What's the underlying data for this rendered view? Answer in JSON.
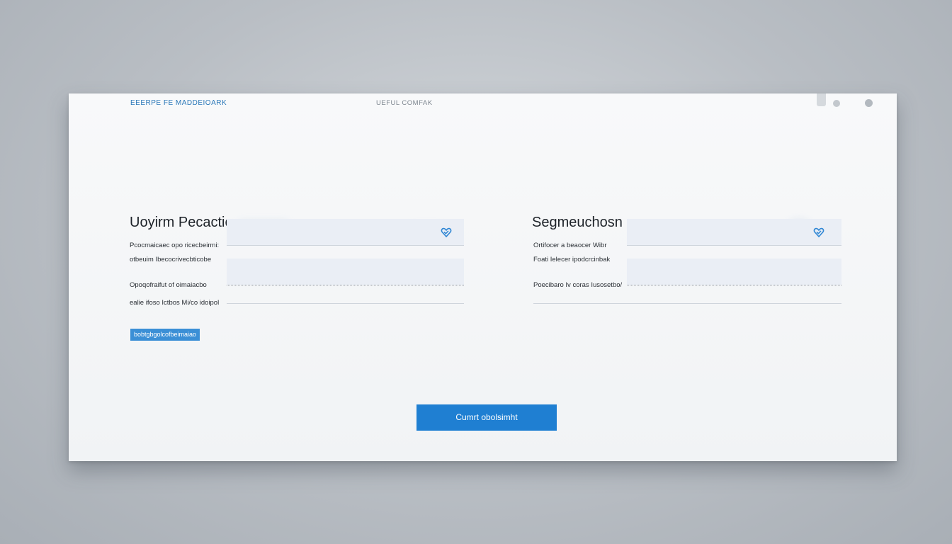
{
  "header": {
    "brand": "EEERPE FE ΜΑDDEIOARK",
    "nav_label": "UEFUL   COMFAK"
  },
  "left_panel": {
    "title": "Uoyirm Pecactio",
    "labels": [
      "Pcocmaicaec opo ricecbeirmi:",
      "otbeuim Ibecocrivecbticobe",
      "Opoqofraifut of oimaiacbo",
      "ealie ifoso Ictbos Mi/co idoipol"
    ],
    "small_button": "bobtgbgolcofbeimaiao"
  },
  "right_panel": {
    "title": "Segmeuchosn",
    "labels": [
      "Ortifocer a beaocer Wibr",
      "Foati  Ielecer ipodcrcinbak",
      "Poecibaro Iv coras Iusosetbo/"
    ]
  },
  "footer": {
    "submit_label": "Cumrt obolsimht"
  },
  "colors": {
    "accent": "#1f7fd2",
    "small_button": "#3b8fd6",
    "brand_text": "#2a78b8",
    "check_icon": "#2f86d4"
  }
}
